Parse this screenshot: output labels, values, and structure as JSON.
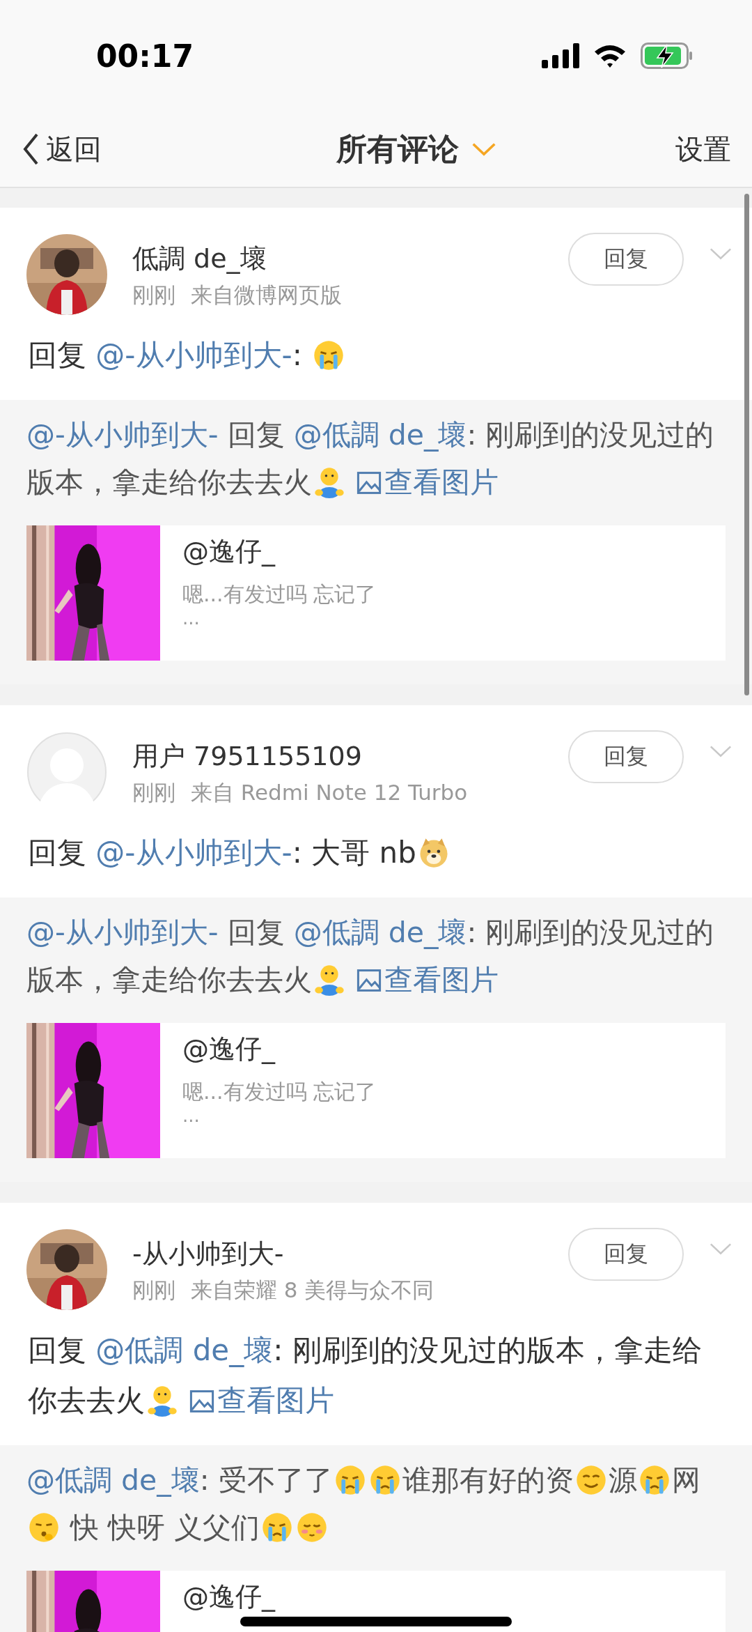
{
  "status_bar": {
    "time": "00:17"
  },
  "nav": {
    "back": "返回",
    "title": "所有评论",
    "settings": "设置"
  },
  "comments": [
    {
      "avatar": {
        "kind": "picture"
      },
      "name": "低調 de_壞",
      "time": "刚刚",
      "source": "来自微博网页版",
      "reply_button": "回复",
      "text": [
        {
          "kind": "text",
          "text": "回复 "
        },
        {
          "kind": "mention",
          "text": "@-从小帅到大-"
        },
        {
          "kind": "text",
          "text": ": "
        },
        {
          "kind": "cry"
        }
      ],
      "quote": [
        {
          "kind": "mention",
          "text": "@-从小帅到大-"
        },
        {
          "kind": "text",
          "text": " 回复 "
        },
        {
          "kind": "mention",
          "text": "@低調 de_壞"
        },
        {
          "kind": "text",
          "text": ": 刚刷到的没见过的版本，拿走给你去去火"
        },
        {
          "kind": "hug"
        },
        {
          "kind": "link",
          "text": "查看图片"
        }
      ],
      "share": {
        "title": "@逸仔_",
        "desc": "嗯...有发过吗 忘记了",
        "more": "..."
      }
    },
    {
      "avatar": {
        "kind": "default"
      },
      "name": "用户 7951155109",
      "time": "刚刚",
      "source": "来自 Redmi Note 12 Turbo",
      "reply_button": "回复",
      "text": [
        {
          "kind": "text",
          "text": "回复 "
        },
        {
          "kind": "mention",
          "text": "@-从小帅到大-"
        },
        {
          "kind": "text",
          "text": ": 大哥 nb"
        },
        {
          "kind": "doge"
        }
      ],
      "quote": [
        {
          "kind": "mention",
          "text": "@-从小帅到大-"
        },
        {
          "kind": "text",
          "text": " 回复 "
        },
        {
          "kind": "mention",
          "text": "@低調 de_壞"
        },
        {
          "kind": "text",
          "text": ": 刚刷到的没见过的版本，拿走给你去去火"
        },
        {
          "kind": "hug"
        },
        {
          "kind": "link",
          "text": "查看图片"
        }
      ],
      "share": {
        "title": "@逸仔_",
        "desc": "嗯...有发过吗 忘记了",
        "more": "..."
      }
    },
    {
      "avatar": {
        "kind": "picture"
      },
      "name": "-从小帅到大-",
      "time": "刚刚",
      "source": "来自荣耀 8 美得与众不同",
      "reply_button": "回复",
      "text": [
        {
          "kind": "text",
          "text": "回复 "
        },
        {
          "kind": "mention",
          "text": "@低調 de_壞"
        },
        {
          "kind": "text",
          "text": ": 刚刷到的没见过的版本，拿走给你去去火"
        },
        {
          "kind": "hug"
        },
        {
          "kind": "link",
          "text": "查看图片"
        }
      ],
      "quote": [
        {
          "kind": "mention",
          "text": "@低調 de_壞"
        },
        {
          "kind": "text",
          "text": ": 受不了了"
        },
        {
          "kind": "cry"
        },
        {
          "kind": "cry"
        },
        {
          "kind": "text",
          "text": "谁那有好的资"
        },
        {
          "kind": "smirk"
        },
        {
          "kind": "text",
          "text": "源"
        },
        {
          "kind": "cry"
        },
        {
          "kind": "text",
          "text": "网"
        },
        {
          "kind": "shush"
        },
        {
          "kind": "text",
          "text": " 快 快呀 义父们"
        },
        {
          "kind": "sob"
        },
        {
          "kind": "shy"
        }
      ],
      "share": {
        "title": "@逸仔_"
      }
    }
  ]
}
